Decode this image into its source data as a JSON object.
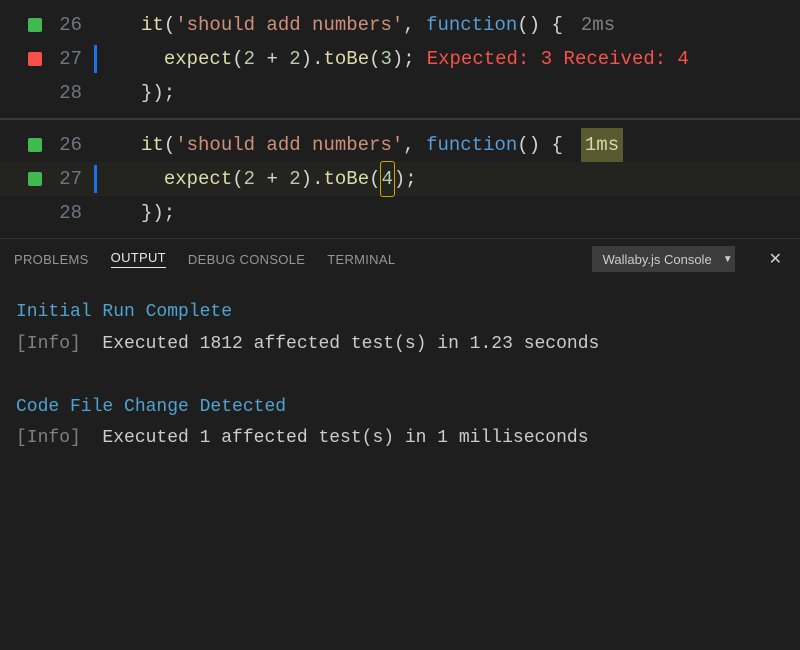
{
  "editor": {
    "panes": [
      {
        "lines": [
          {
            "n": 26,
            "marker": "green",
            "change": false,
            "hl": false,
            "tokens": [
              [
                "func",
                "it"
              ],
              [
                "plain",
                "("
              ],
              [
                "str",
                "'should add numbers'"
              ],
              [
                "plain",
                ", "
              ],
              [
                "key",
                "function"
              ],
              [
                "plain",
                "() {"
              ]
            ],
            "timing": "2ms",
            "timing_hl": false,
            "error": ""
          },
          {
            "n": 27,
            "marker": "red",
            "change": true,
            "hl": false,
            "tokens": [
              [
                "plain",
                "  "
              ],
              [
                "func",
                "expect"
              ],
              [
                "plain",
                "("
              ],
              [
                "num",
                "2"
              ],
              [
                "plain",
                " + "
              ],
              [
                "num",
                "2"
              ],
              [
                "plain",
                ")."
              ],
              [
                "func",
                "toBe"
              ],
              [
                "plain",
                "("
              ],
              [
                "num",
                "3"
              ],
              [
                "plain",
                ");"
              ]
            ],
            "timing": "",
            "timing_hl": false,
            "error": "Expected: 3 Received: 4"
          },
          {
            "n": 28,
            "marker": "none",
            "change": false,
            "hl": false,
            "tokens": [
              [
                "plain",
                "});"
              ]
            ],
            "timing": "",
            "timing_hl": false,
            "error": ""
          }
        ]
      },
      {
        "lines": [
          {
            "n": 26,
            "marker": "green",
            "change": false,
            "hl": false,
            "tokens": [
              [
                "func",
                "it"
              ],
              [
                "plain",
                "("
              ],
              [
                "str",
                "'should add numbers'"
              ],
              [
                "plain",
                ", "
              ],
              [
                "key",
                "function"
              ],
              [
                "plain",
                "() {"
              ]
            ],
            "timing": "1ms",
            "timing_hl": true,
            "error": ""
          },
          {
            "n": 27,
            "marker": "green",
            "change": true,
            "hl": true,
            "tokens": [
              [
                "plain",
                "  "
              ],
              [
                "func",
                "expect"
              ],
              [
                "plain",
                "("
              ],
              [
                "num",
                "2"
              ],
              [
                "plain",
                " + "
              ],
              [
                "num",
                "2"
              ],
              [
                "plain",
                ")."
              ],
              [
                "func",
                "toBe"
              ],
              [
                "plain",
                "("
              ],
              [
                "numhl",
                "4"
              ],
              [
                "plain",
                ");"
              ]
            ],
            "timing": "",
            "timing_hl": false,
            "error": ""
          },
          {
            "n": 28,
            "marker": "none",
            "change": false,
            "hl": false,
            "tokens": [
              [
                "plain",
                "});"
              ]
            ],
            "timing": "",
            "timing_hl": false,
            "error": ""
          }
        ]
      }
    ]
  },
  "panel": {
    "tabs": [
      "PROBLEMS",
      "OUTPUT",
      "DEBUG CONSOLE",
      "TERMINAL"
    ],
    "active_tab": 1,
    "dropdown": "Wallaby.js Console",
    "log": [
      {
        "heading": "Initial Run Complete"
      },
      {
        "info": "Executed 1812 affected test(s) in 1.23 seconds"
      },
      {
        "blank": true
      },
      {
        "heading": "Code File Change Detected"
      },
      {
        "info": "Executed 1 affected test(s) in 1 milliseconds"
      }
    ]
  },
  "icons": {
    "close": "✕",
    "caret": "▼"
  }
}
